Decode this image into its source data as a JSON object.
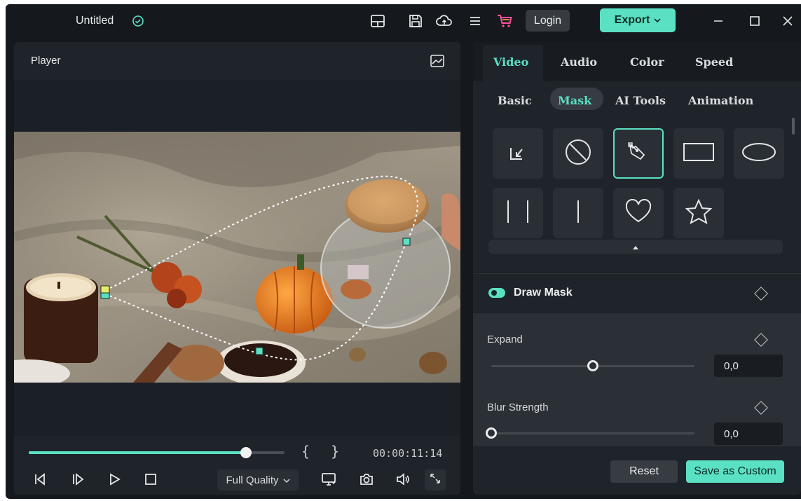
{
  "titlebar": {
    "project_title": "Untitled",
    "login_label": "Login",
    "export_label": "Export",
    "icons": [
      "saved-check-icon",
      "layout-icon",
      "save-icon",
      "cloud-upload-icon",
      "menu-icon",
      "cart-icon",
      "minimize-icon",
      "maximize-icon",
      "close-icon"
    ]
  },
  "player": {
    "title": "Player",
    "timecode": "00:00:11:14",
    "progress": 0.85,
    "mark_in": "{",
    "mark_out": "}",
    "quality_label": "Full Quality"
  },
  "panel": {
    "main_tabs": [
      {
        "label": "Video",
        "active": true
      },
      {
        "label": "Audio",
        "active": false
      },
      {
        "label": "Color",
        "active": false
      },
      {
        "label": "Speed",
        "active": false
      }
    ],
    "sub_tabs": [
      {
        "label": "Basic",
        "active": false
      },
      {
        "label": "Mask",
        "active": true
      },
      {
        "label": "AI Tools",
        "active": false
      },
      {
        "label": "Animation",
        "active": false
      }
    ],
    "mask_shapes": [
      "import-mask",
      "none",
      "draw-pen",
      "rectangle",
      "ellipse",
      "double-line",
      "single-line",
      "heart",
      "star"
    ],
    "selected_mask": "draw-pen",
    "section_title": "Draw Mask",
    "properties": [
      {
        "label": "Expand",
        "value": "0,0",
        "slider": 0.5
      },
      {
        "label": "Blur Strength",
        "value": "0,0",
        "slider": 0.0
      }
    ],
    "reset_label": "Reset",
    "save_label": "Save as Custom"
  },
  "colors": {
    "accent": "#5ae0c3",
    "bg": "#15191d",
    "panel": "#1f242a"
  }
}
